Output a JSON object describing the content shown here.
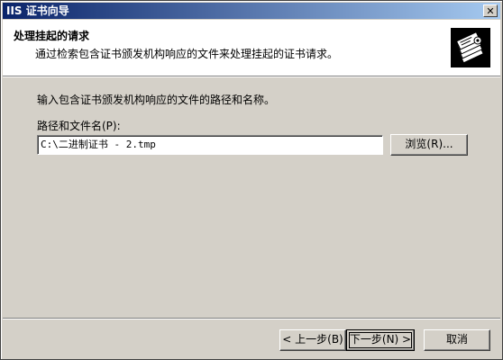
{
  "window": {
    "title": "IIS 证书向导",
    "close_glyph": "✕"
  },
  "header": {
    "title": "处理挂起的请求",
    "subtitle": "通过检索包含证书颁发机构响应的文件来处理挂起的证书请求。",
    "icon": "certificate-icon"
  },
  "body": {
    "intro": "输入包含证书颁发机构响应的文件的路径和名称。",
    "path_label": "路径和文件名(P):",
    "path_value": "C:\\二进制证书 - 2.tmp",
    "browse_label": "浏览(R)..."
  },
  "footer": {
    "back_label": "< 上一步(B)",
    "next_label": "下一步(N) >",
    "cancel_label": "取消"
  },
  "colors": {
    "title_start": "#0a246a",
    "title_end": "#a6caf0",
    "face": "#d4d0c8"
  }
}
